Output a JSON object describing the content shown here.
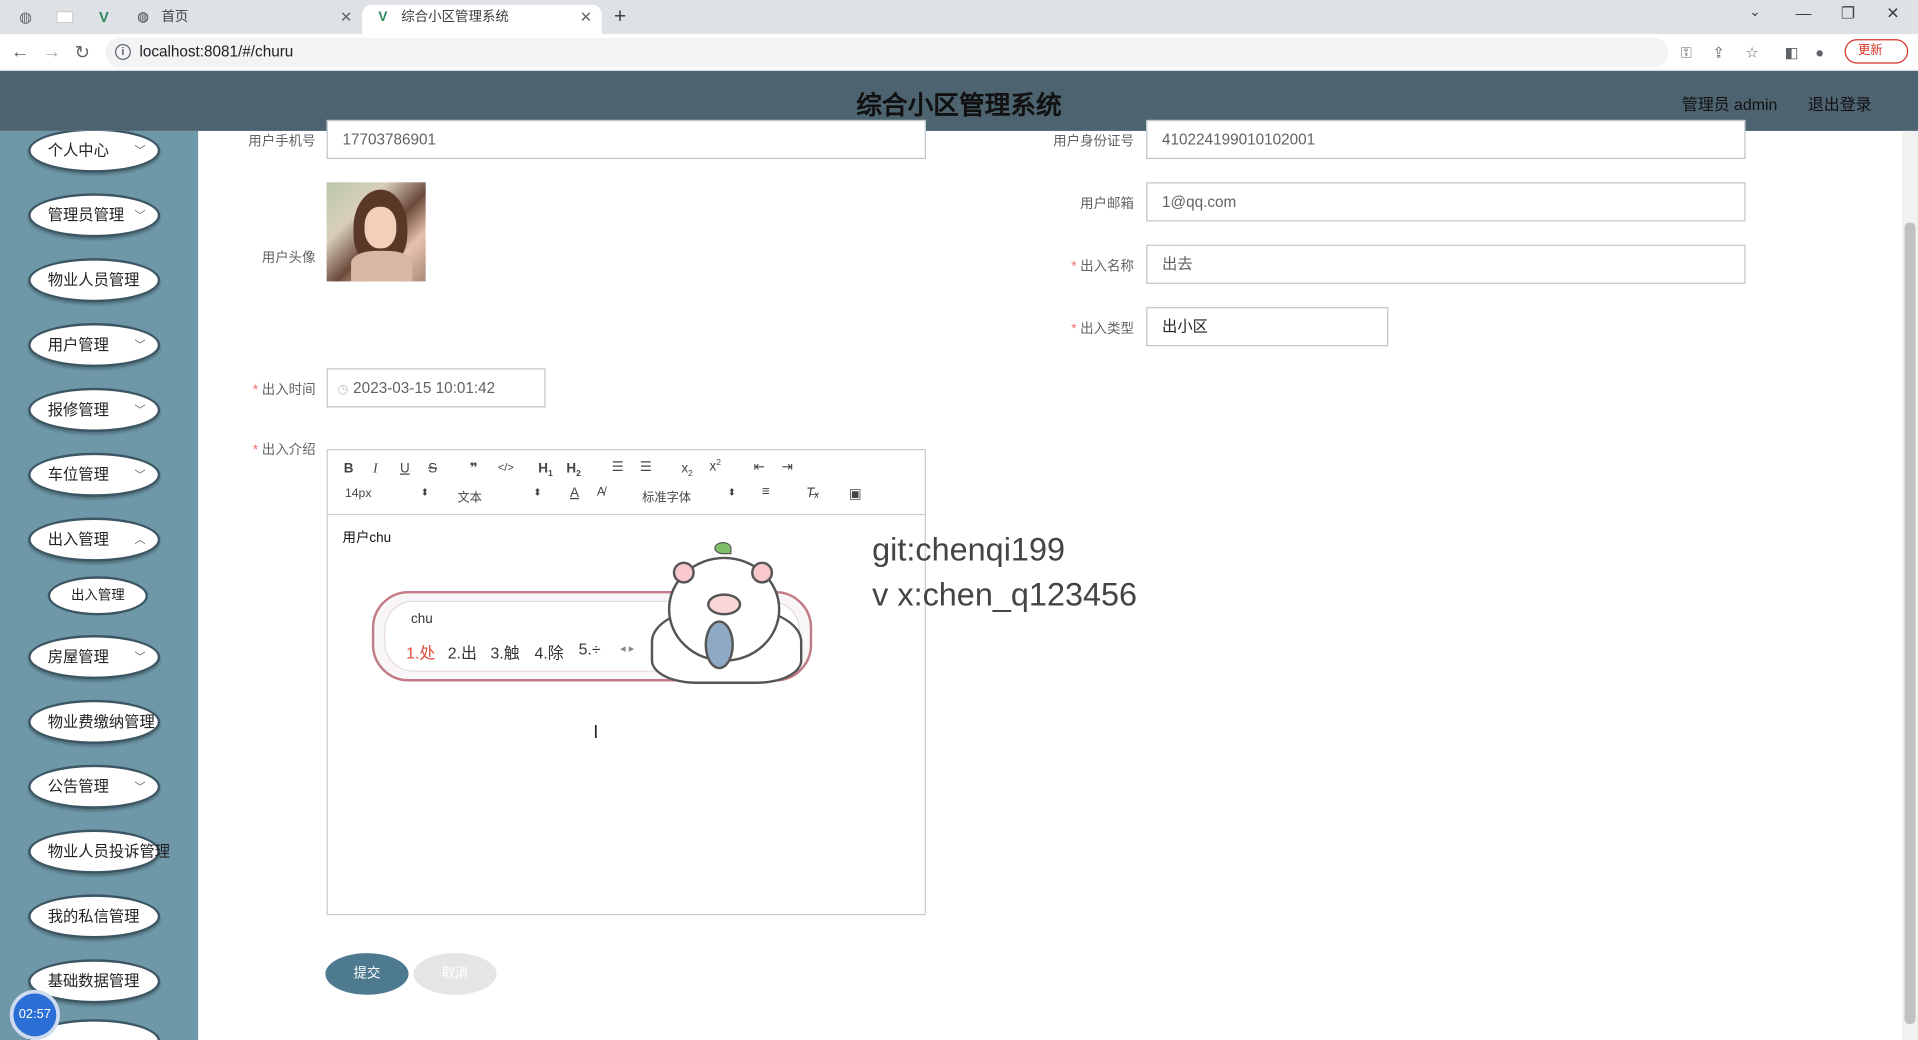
{
  "browser": {
    "tabs": [
      {
        "title": "首页",
        "active": false
      },
      {
        "title": "综合小区管理系统",
        "active": true
      }
    ],
    "url": "localhost:8081/#/churu",
    "update_label": "更新"
  },
  "header": {
    "title": "综合小区管理系统",
    "user_label": "管理员 admin",
    "logout_label": "退出登录"
  },
  "sidebar": {
    "items": [
      {
        "label": "个人中心",
        "has_submenu": true
      },
      {
        "label": "管理员管理",
        "has_submenu": true
      },
      {
        "label": "物业人员管理",
        "has_submenu": false
      },
      {
        "label": "用户管理",
        "has_submenu": true
      },
      {
        "label": "报修管理",
        "has_submenu": true
      },
      {
        "label": "车位管理",
        "has_submenu": true
      },
      {
        "label": "出入管理",
        "has_submenu": true
      },
      {
        "label": "房屋管理",
        "has_submenu": true
      },
      {
        "label": "物业费缴纳管理",
        "has_submenu": false
      },
      {
        "label": "公告管理",
        "has_submenu": true
      },
      {
        "label": "物业人员投诉管理",
        "has_submenu": false
      },
      {
        "label": "我的私信管理",
        "has_submenu": false
      },
      {
        "label": "基础数据管理",
        "has_submenu": false
      }
    ],
    "submenu_active": "出入管理",
    "clock": "02:57"
  },
  "form": {
    "phone_label": "用户手机号",
    "phone_value": "17703786901",
    "idcard_label": "用户身份证号",
    "idcard_value": "410224199010102001",
    "avatar_label": "用户头像",
    "email_label": "用户邮箱",
    "email_value": "1@qq.com",
    "name_label": "出入名称",
    "name_value": "出去",
    "type_label": "出入类型",
    "type_value": "出小区",
    "time_label": "出入时间",
    "time_value": "2023-03-15 10:01:42",
    "intro_label": "出入介绍",
    "submit_label": "提交",
    "cancel_label": "取消"
  },
  "editor": {
    "font_size": "14px",
    "block_format": "文本",
    "font_family": "标准字体",
    "content": "用户chu"
  },
  "ime": {
    "pinyin": "chu",
    "candidates": [
      "1.处",
      "2.出",
      "3.触",
      "4.除",
      "5.÷"
    ]
  },
  "watermark": {
    "line1": "git:chenqi199",
    "line2": "v x:chen_q123456"
  }
}
